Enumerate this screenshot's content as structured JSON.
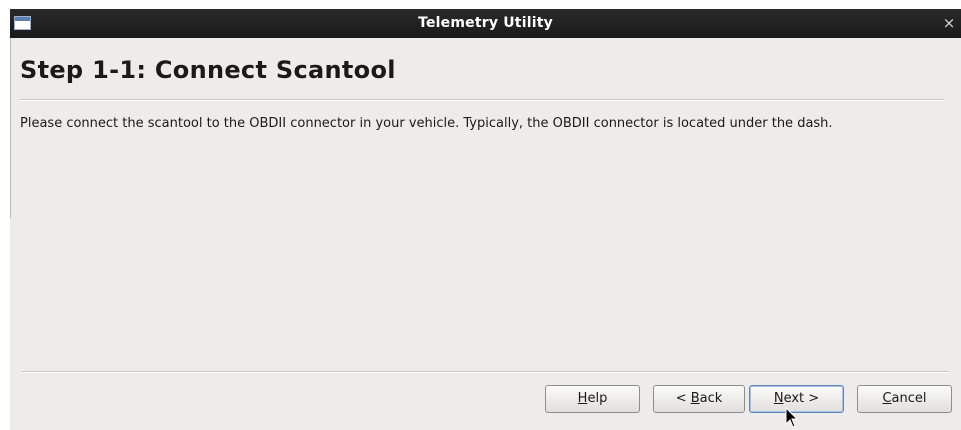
{
  "window": {
    "title": "Telemetry Utility",
    "close_glyph": "×",
    "icon": "window-icon"
  },
  "page": {
    "heading": "Step 1-1: Connect Scantool",
    "description": "Please connect the scantool to the OBDII connector in your vehicle. Typically, the OBDII connector is located under the dash."
  },
  "buttons": {
    "help": {
      "accel": "H",
      "rest": "elp"
    },
    "back": {
      "pre": "< ",
      "accel": "B",
      "rest": "ack"
    },
    "next": {
      "accel": "N",
      "rest": "ext >"
    },
    "cancel": {
      "accel": "C",
      "rest": "ancel"
    }
  },
  "colors": {
    "titlebar": "#1f1f1f",
    "window_bg": "#edeceb",
    "focus_border": "#5f86b8"
  }
}
